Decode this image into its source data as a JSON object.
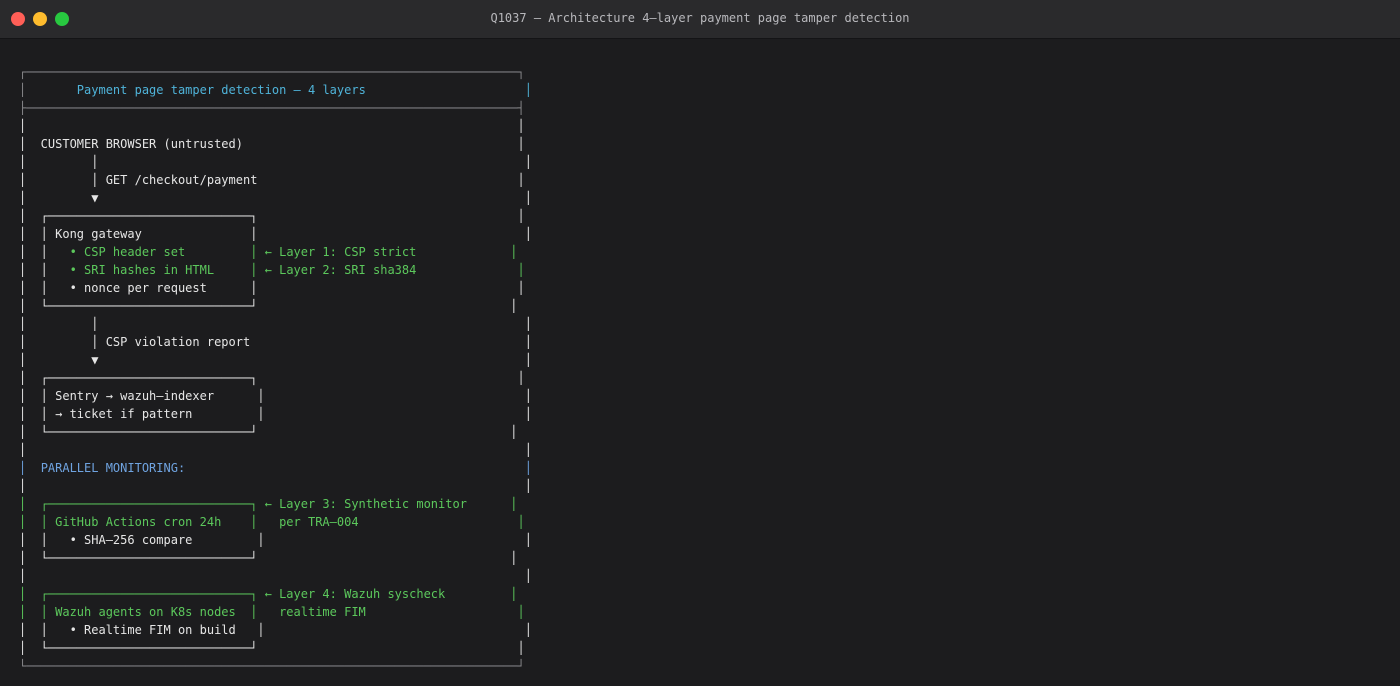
{
  "window": {
    "title": "Q1037 — Architecture 4–layer payment page tamper detection"
  },
  "colors": {
    "border": "#8a8a8e",
    "white": "#e6e6e6",
    "cyan": "#4fb3d9",
    "green": "#5cc85c",
    "blue": "#6fa3e0"
  },
  "lines": [
    {
      "segments": [
        {
          "text": "┌────────────────────────────────────────────────────────────────────┐",
          "color": "border"
        }
      ]
    },
    {
      "segments": [
        {
          "text": "│",
          "color": "border"
        },
        {
          "text": "       Payment page tamper detection — 4 layers",
          "color": "cyan"
        },
        {
          "text": "                      │",
          "color": "cyan"
        }
      ]
    },
    {
      "segments": [
        {
          "text": "├────────────────────────────────────────────────────────────────────┤",
          "color": "border"
        }
      ]
    },
    {
      "segments": [
        {
          "text": "│                                                                    │",
          "color": "white"
        }
      ]
    },
    {
      "segments": [
        {
          "text": "│  CUSTOMER BROWSER (untrusted)                                      │",
          "color": "white"
        }
      ]
    },
    {
      "segments": [
        {
          "text": "│         │                                                           │",
          "color": "white"
        }
      ]
    },
    {
      "segments": [
        {
          "text": "│         │ GET /checkout/payment                                    │",
          "color": "white"
        }
      ]
    },
    {
      "segments": [
        {
          "text": "│         ▼                                                           │",
          "color": "white"
        }
      ]
    },
    {
      "segments": [
        {
          "text": "│  ┌────────────────────────────┐                                    │",
          "color": "white"
        }
      ]
    },
    {
      "segments": [
        {
          "text": "│  │ Kong gateway               │                                     │",
          "color": "white"
        }
      ]
    },
    {
      "segments": [
        {
          "text": "│  │ ",
          "color": "white"
        },
        {
          "text": "  • CSP header set         │ ← Layer 1: CSP strict             │",
          "color": "green"
        }
      ]
    },
    {
      "segments": [
        {
          "text": "│  │ ",
          "color": "white"
        },
        {
          "text": "  • SRI hashes in HTML     │ ← Layer 2: SRI sha384              │",
          "color": "green"
        }
      ]
    },
    {
      "segments": [
        {
          "text": "│  │   • nonce per request      │                                    │",
          "color": "white"
        }
      ]
    },
    {
      "segments": [
        {
          "text": "│  └────────────────────────────┘                                   │",
          "color": "white"
        }
      ]
    },
    {
      "segments": [
        {
          "text": "│         │                                                           │",
          "color": "white"
        }
      ]
    },
    {
      "segments": [
        {
          "text": "│         │ CSP violation report                                      │",
          "color": "white"
        }
      ]
    },
    {
      "segments": [
        {
          "text": "│         ▼                                                           │",
          "color": "white"
        }
      ]
    },
    {
      "segments": [
        {
          "text": "│  ┌────────────────────────────┐                                    │",
          "color": "white"
        }
      ]
    },
    {
      "segments": [
        {
          "text": "│  │ Sentry → wazuh–indexer      │                                    │",
          "color": "white"
        }
      ]
    },
    {
      "segments": [
        {
          "text": "│  │ → ticket if pattern         │                                    │",
          "color": "white"
        }
      ]
    },
    {
      "segments": [
        {
          "text": "│  └────────────────────────────┘                                   │",
          "color": "white"
        }
      ]
    },
    {
      "segments": [
        {
          "text": "│                                                                     │",
          "color": "white"
        }
      ]
    },
    {
      "segments": [
        {
          "text": "│  ",
          "color": "blue"
        },
        {
          "text": "PARALLEL MONITORING:",
          "color": "blue"
        },
        {
          "text": "                                               │",
          "color": "blue"
        }
      ]
    },
    {
      "segments": [
        {
          "text": "│                                                                     │",
          "color": "white"
        }
      ]
    },
    {
      "segments": [
        {
          "text": "│  ┌────────────────────────────┐ ← Layer 3: Synthetic monitor      │",
          "color": "green"
        }
      ]
    },
    {
      "segments": [
        {
          "text": "│  │ GitHub Actions cron 24h    │   per TRA–004                      │",
          "color": "green"
        }
      ]
    },
    {
      "segments": [
        {
          "text": "│  │   • SHA–256 compare         │                                    │",
          "color": "white"
        }
      ]
    },
    {
      "segments": [
        {
          "text": "│  └────────────────────────────┘                                   │",
          "color": "white"
        }
      ]
    },
    {
      "segments": [
        {
          "text": "│                                                                     │",
          "color": "white"
        }
      ]
    },
    {
      "segments": [
        {
          "text": "│  ┌────────────────────────────┐ ← Layer 4: Wazuh syscheck         │",
          "color": "green"
        }
      ]
    },
    {
      "segments": [
        {
          "text": "│  │ Wazuh agents on K8s nodes  │   realtime FIM                     │",
          "color": "green"
        }
      ]
    },
    {
      "segments": [
        {
          "text": "│  │   • Realtime FIM on build   │                                    │",
          "color": "white"
        }
      ]
    },
    {
      "segments": [
        {
          "text": "│  └────────────────────────────┘                                    │",
          "color": "white"
        }
      ]
    },
    {
      "segments": [
        {
          "text": "└────────────────────────────────────────────────────────────────────┘",
          "color": "border"
        }
      ]
    }
  ]
}
